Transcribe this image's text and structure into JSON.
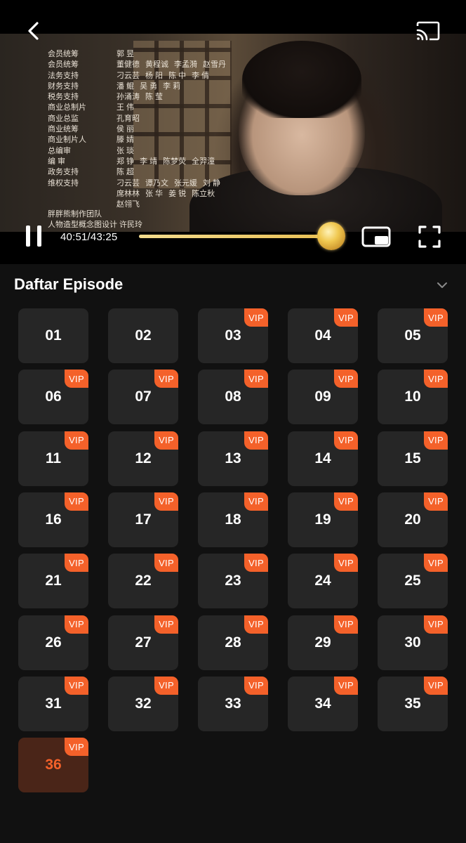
{
  "player": {
    "credits": [
      {
        "role": "会员统筹",
        "names": [
          "郭 昱"
        ]
      },
      {
        "role": "会员统筹",
        "names": [
          "董健德",
          "黄程诚",
          "李孟漪",
          "赵雪丹"
        ]
      },
      {
        "role": "法务支持",
        "names": [
          "刁云芸",
          "杨 阳",
          "陈 中",
          "李 倩"
        ]
      },
      {
        "role": "财务支持",
        "names": [
          "潘 鲲",
          "吴 勇",
          "李 莉"
        ]
      },
      {
        "role": "税务支持",
        "names": [
          "孙涌涛",
          "陈 莹"
        ]
      },
      {
        "role": "商业总制片",
        "names": [
          "王 伟"
        ]
      },
      {
        "role": "商业总监",
        "names": [
          "孔育昭"
        ]
      },
      {
        "role": "商业统筹",
        "names": [
          "侯 丽"
        ]
      },
      {
        "role": "商业制片人",
        "names": [
          "滕 婧"
        ]
      },
      {
        "role": "总编审",
        "names": [
          "张 琰"
        ]
      },
      {
        "role": "编 审",
        "names": [
          "郑 铮",
          "李 靖",
          "陈梦荧",
          "全羿潼"
        ]
      },
      {
        "role": "政务支持",
        "names": [
          "陈 超"
        ]
      },
      {
        "role": "维权支持",
        "names": [
          "刁云芸",
          "谭乃文",
          "张元媛",
          "刘 静"
        ]
      },
      {
        "role": "",
        "names": [
          "席林林",
          "张 华",
          "姜 锐",
          "陈立秋"
        ]
      },
      {
        "role": "",
        "names": [
          "赵翎飞"
        ]
      }
    ],
    "credits_footer": [
      "胖胖熊制作团队",
      "人物造型概念图设计 许民玲"
    ],
    "time": "40:51/43:25",
    "progress_fraction": 0.94,
    "accent_color": "#f4612a"
  },
  "episode_list": {
    "title": "Daftar Episode",
    "vip_label": "VIP",
    "current_episode": "36",
    "episodes": [
      {
        "num": "01",
        "vip": false
      },
      {
        "num": "02",
        "vip": false
      },
      {
        "num": "03",
        "vip": true
      },
      {
        "num": "04",
        "vip": true
      },
      {
        "num": "05",
        "vip": true
      },
      {
        "num": "06",
        "vip": true
      },
      {
        "num": "07",
        "vip": true
      },
      {
        "num": "08",
        "vip": true
      },
      {
        "num": "09",
        "vip": true
      },
      {
        "num": "10",
        "vip": true
      },
      {
        "num": "11",
        "vip": true
      },
      {
        "num": "12",
        "vip": true
      },
      {
        "num": "13",
        "vip": true
      },
      {
        "num": "14",
        "vip": true
      },
      {
        "num": "15",
        "vip": true
      },
      {
        "num": "16",
        "vip": true
      },
      {
        "num": "17",
        "vip": true
      },
      {
        "num": "18",
        "vip": true
      },
      {
        "num": "19",
        "vip": true
      },
      {
        "num": "20",
        "vip": true
      },
      {
        "num": "21",
        "vip": true
      },
      {
        "num": "22",
        "vip": true
      },
      {
        "num": "23",
        "vip": true
      },
      {
        "num": "24",
        "vip": true
      },
      {
        "num": "25",
        "vip": true
      },
      {
        "num": "26",
        "vip": true
      },
      {
        "num": "27",
        "vip": true
      },
      {
        "num": "28",
        "vip": true
      },
      {
        "num": "29",
        "vip": true
      },
      {
        "num": "30",
        "vip": true
      },
      {
        "num": "31",
        "vip": true
      },
      {
        "num": "32",
        "vip": true
      },
      {
        "num": "33",
        "vip": true
      },
      {
        "num": "34",
        "vip": true
      },
      {
        "num": "35",
        "vip": true
      },
      {
        "num": "36",
        "vip": true
      }
    ]
  }
}
